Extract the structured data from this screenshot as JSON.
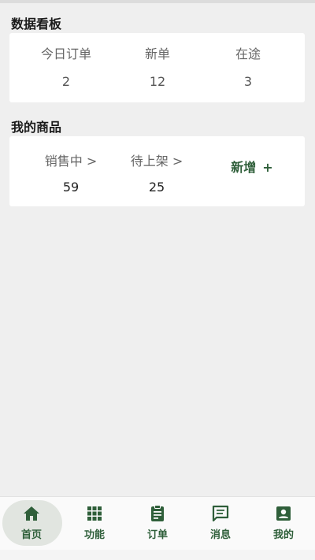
{
  "dashboard": {
    "title": "数据看板",
    "stats": [
      {
        "label": "今日订单",
        "value": "2"
      },
      {
        "label": "新单",
        "value": "12"
      },
      {
        "label": "在途",
        "value": "3"
      }
    ]
  },
  "products": {
    "title": "我的商品",
    "items": [
      {
        "label": "销售中 >",
        "value": "59"
      },
      {
        "label": "待上架 >",
        "value": "25"
      }
    ],
    "add_label": "新增",
    "add_plus": "+"
  },
  "tabbar": {
    "accent": "#2f5f3a",
    "active_index": 0,
    "tabs": [
      {
        "label": "首页",
        "icon": "home-icon"
      },
      {
        "label": "功能",
        "icon": "grid-icon"
      },
      {
        "label": "订单",
        "icon": "clipboard-icon"
      },
      {
        "label": "消息",
        "icon": "message-icon"
      },
      {
        "label": "我的",
        "icon": "profile-icon"
      }
    ]
  }
}
